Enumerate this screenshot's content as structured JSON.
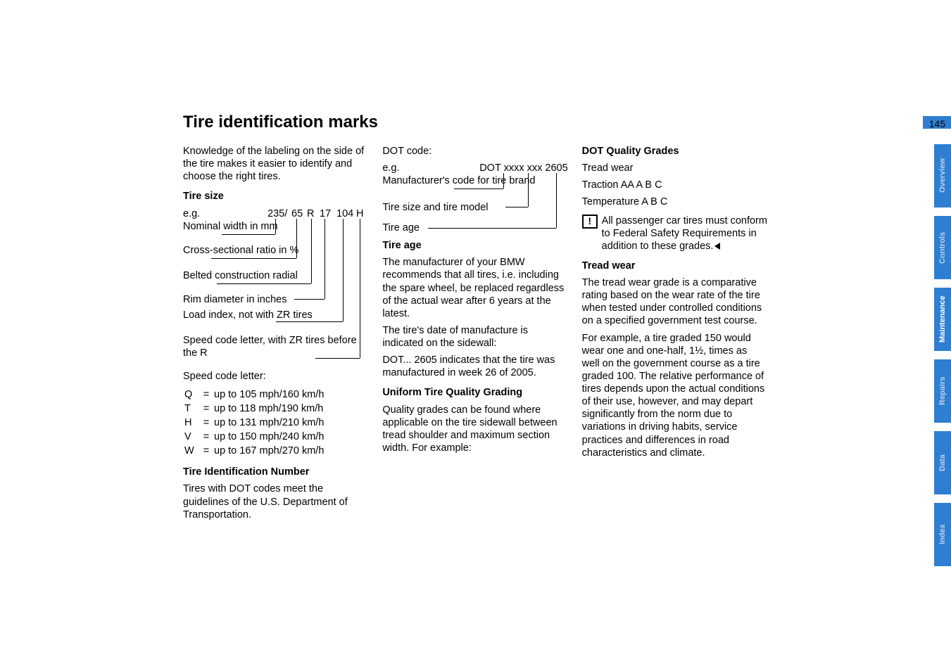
{
  "page_number": "145",
  "title": "Tire identification marks",
  "intro": "Knowledge of the labeling on the side of the tire makes it easier to identify and choose the right tires.",
  "tire_size": {
    "heading": "Tire size",
    "eg": "e.g.",
    "parts": {
      "p235": "235/",
      "p65": "65",
      "pR": "R",
      "p17": "17",
      "p104": "104",
      "pH": "H"
    },
    "labels": {
      "nominal": "Nominal width in mm",
      "csr": "Cross-sectional ratio in %",
      "belted": "Belted construction radial",
      "rim": "Rim diameter in inches",
      "load": "Load index, not with ZR tires",
      "speed": "Speed code letter, with ZR tires before the R"
    }
  },
  "speed_code": {
    "intro": "Speed code letter:",
    "rows": [
      {
        "l": "Q",
        "eq": "=",
        "v": "up to 105 mph/160 km/h"
      },
      {
        "l": "T",
        "eq": "=",
        "v": "up to 118 mph/190 km/h"
      },
      {
        "l": "H",
        "eq": "=",
        "v": "up to 131 mph/210 km/h"
      },
      {
        "l": "V",
        "eq": "=",
        "v": "up to 150 mph/240 km/h"
      },
      {
        "l": "W",
        "eq": "=",
        "v": "up to 167 mph/270 km/h"
      }
    ]
  },
  "tin": {
    "heading": "Tire Identification Number",
    "body": "Tires with DOT codes meet the guidelines of the U.S. Department of Transportation."
  },
  "dot": {
    "heading": "DOT code:",
    "eg": "e.g.",
    "example": "DOT xxxx xxx 2605",
    "labels": {
      "mfr": "Manufacturer's code for tire brand",
      "size": "Tire size and tire model",
      "age": "Tire age"
    }
  },
  "tire_age": {
    "heading": "Tire age",
    "p1": "The manufacturer of your BMW recommends that all tires, i.e. including the spare wheel, be replaced regardless of the actual wear after 6 years at the latest.",
    "p2": "The tire's date of manufacture is indicated on the sidewall:",
    "p3": "DOT... 2605 indicates that the tire was manufactured in week 26 of 2005."
  },
  "utqg": {
    "heading": "Uniform Tire Quality Grading",
    "body": "Quality grades can be found where applicable on the tire sidewall between tread shoulder and maximum section width. For example:"
  },
  "dqg": {
    "heading": "DOT Quality Grades",
    "l1": "Tread wear",
    "l2": "Traction AA A B C",
    "l3": "Temperature A B C",
    "warn": "All passenger car tires must conform to Federal Safety Requirements in addition to these grades."
  },
  "tread_wear": {
    "heading": "Tread wear",
    "p1": "The tread wear grade is a comparative rating based on the wear rate of the tire when tested under controlled conditions on a specified government test course.",
    "p2": "For example, a tire graded 150 would wear one and one-half, 1½, times as well on the government course as a tire graded 100. The relative performance of tires depends upon the actual conditions of their use, however, and may depart significantly from the norm due to variations in driving habits, service practices and differences in road characteristics and climate."
  },
  "tabs": [
    "Overview",
    "Controls",
    "Maintenance",
    "Repairs",
    "Data",
    "Index"
  ],
  "active_tab": "Maintenance",
  "warn_glyph": "!"
}
